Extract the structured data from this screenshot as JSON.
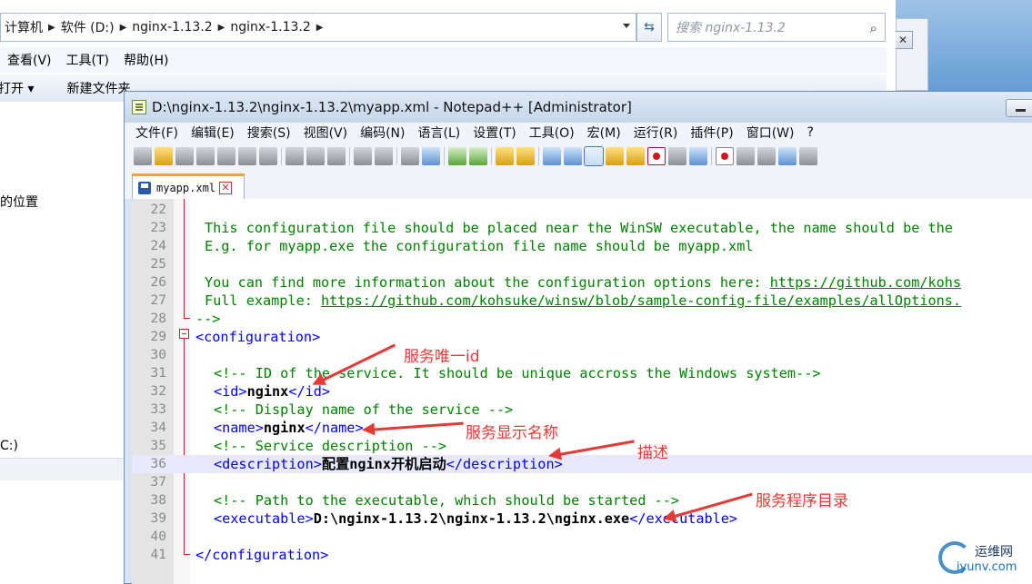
{
  "explorer": {
    "breadcrumb": [
      "计算机",
      "软件 (D:)",
      "nginx-1.13.2",
      "nginx-1.13.2"
    ],
    "search_placeholder": "搜索 nginx-1.13.2",
    "menu": [
      "查看(V)",
      "工具(T)",
      "帮助(H)"
    ],
    "toolbar_open": "打开",
    "toolbar_new_folder": "新建文件夹",
    "side_text_1": "的位置",
    "side_text_2": "C:)"
  },
  "npp": {
    "title": "D:\\nginx-1.13.2\\nginx-1.13.2\\myapp.xml - Notepad++ [Administrator]",
    "menu": [
      "文件(F)",
      "编辑(E)",
      "搜索(S)",
      "视图(V)",
      "编码(N)",
      "语言(L)",
      "设置(T)",
      "工具(O)",
      "宏(M)",
      "运行(R)",
      "插件(P)",
      "窗口(W)",
      "?"
    ],
    "tab_name": "myapp.xml",
    "lines": [
      {
        "n": "22",
        "t": ""
      },
      {
        "n": "23",
        "t": "This configuration file should be placed near the WinSW executable, the name should be the"
      },
      {
        "n": "24",
        "t": "E.g. for myapp.exe the configuration file name should be myapp.xml"
      },
      {
        "n": "25",
        "t": ""
      },
      {
        "n": "26",
        "t": "You can find more information about the configuration options here: ",
        "link": "https://github.com/kohs"
      },
      {
        "n": "27",
        "t": "Full example: ",
        "link": "https://github.com/kohsuke/winsw/blob/sample-config-file/examples/allOptions."
      },
      {
        "n": "28",
        "t": "-->"
      },
      {
        "n": "29",
        "t": "<configuration>"
      },
      {
        "n": "30",
        "t": ""
      },
      {
        "n": "31",
        "t": "<!-- ID of the service. It should be unique accross the Windows system-->"
      },
      {
        "n": "32",
        "open": "<id>",
        "val": "nginx",
        "close": "</id>"
      },
      {
        "n": "33",
        "t": "<!-- Display name of the service -->"
      },
      {
        "n": "34",
        "open": "<name>",
        "val": "nginx",
        "close": "</name>"
      },
      {
        "n": "35",
        "t": "<!-- Service description -->"
      },
      {
        "n": "36",
        "open": "<description>",
        "val": "配置nginx开机启动",
        "close": "</description>"
      },
      {
        "n": "37",
        "t": ""
      },
      {
        "n": "38",
        "t": "<!-- Path to the executable, which should be started -->"
      },
      {
        "n": "39",
        "open": "<executable>",
        "val": "D:\\nginx-1.13.2\\nginx-1.13.2\\nginx.exe",
        "close": "</executable>"
      },
      {
        "n": "40",
        "t": ""
      },
      {
        "n": "41",
        "t": "</configuration>"
      }
    ]
  },
  "annotations": {
    "id": "服务唯一id",
    "name": "服务显示名称",
    "desc": "描述",
    "exe": "服务程序目录"
  },
  "watermark": {
    "cn": "运维网",
    "url": "iyunv.com"
  },
  "colors": {
    "comment": "#008000",
    "tag": "#0000ff",
    "annotation": "#e53935",
    "highlight_line": "#e8e8ff"
  }
}
